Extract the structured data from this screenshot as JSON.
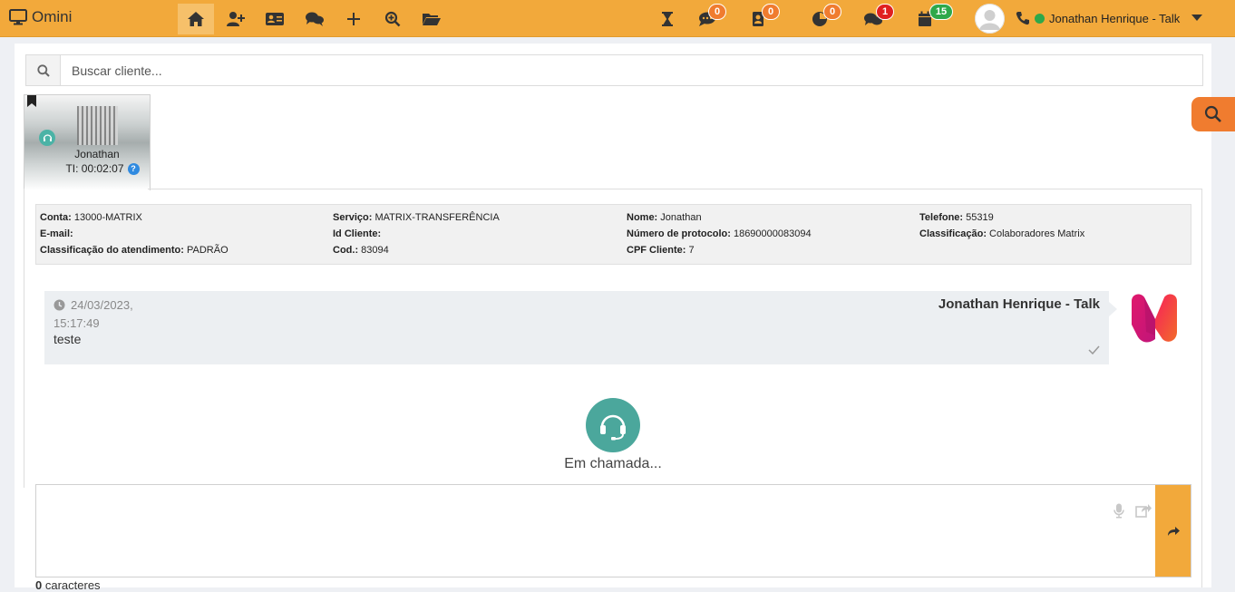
{
  "app": {
    "title": "Omini"
  },
  "topbar": {
    "nav": [
      {
        "name": "home-icon",
        "active": true
      },
      {
        "name": "add-user-icon"
      },
      {
        "name": "contact-card-icon"
      },
      {
        "name": "chat-icon"
      },
      {
        "name": "plus-icon"
      },
      {
        "name": "zoom-in-icon"
      },
      {
        "name": "folder-open-icon"
      }
    ],
    "status": [
      {
        "name": "hourglass-icon",
        "badge": null
      },
      {
        "name": "comment-icon",
        "badge": "0",
        "badge_color": "#f07c2f"
      },
      {
        "name": "user-badge-icon",
        "badge": "0",
        "badge_color": "#f07c2f"
      },
      {
        "name": "pie-clock-icon",
        "badge": "0",
        "badge_color": "#f07c2f"
      },
      {
        "name": "chats-icon",
        "badge": "1",
        "badge_color": "#e02020"
      },
      {
        "name": "calendar-icon",
        "badge": "15",
        "badge_color": "#2ea84a"
      }
    ],
    "user_name": "Jonathan Henrique - Talk",
    "user_status_color": "#2ea84a"
  },
  "search": {
    "placeholder": "Buscar cliente..."
  },
  "contact": {
    "name": "Jonathan",
    "timer": "TI: 00:02:07",
    "help": "?"
  },
  "info": {
    "conta": {
      "label": "Conta:",
      "value": "13000-MATRIX"
    },
    "email": {
      "label": "E-mail:",
      "value": ""
    },
    "classificacao_atendimento": {
      "label": "Classificação do atendimento:",
      "value": "PADRÃO"
    },
    "servico": {
      "label": "Serviço:",
      "value": "MATRIX-TRANSFERÊNCIA"
    },
    "id_cliente": {
      "label": "Id Cliente:",
      "value": ""
    },
    "cod": {
      "label": "Cod.:",
      "value": "83094"
    },
    "nome": {
      "label": "Nome:",
      "value": "Jonathan"
    },
    "protocolo": {
      "label": "Número de protocolo:",
      "value": "18690000083094"
    },
    "cpf": {
      "label": "CPF Cliente:",
      "value": "7"
    },
    "telefone": {
      "label": "Telefone:",
      "value": "55319"
    },
    "classificacao": {
      "label": "Classificação:",
      "value": "Colaboradores Matrix"
    }
  },
  "message": {
    "date": "24/03/2023, 15:17:49",
    "sender": "Jonathan Henrique - Talk",
    "text": "teste"
  },
  "call": {
    "status": "Em chamada..."
  },
  "composer": {
    "char_count": "0",
    "char_label": "caracteres"
  },
  "colors": {
    "accent": "#f2a93b",
    "call": "#4ba79c",
    "float_search": "#f07c2f"
  }
}
